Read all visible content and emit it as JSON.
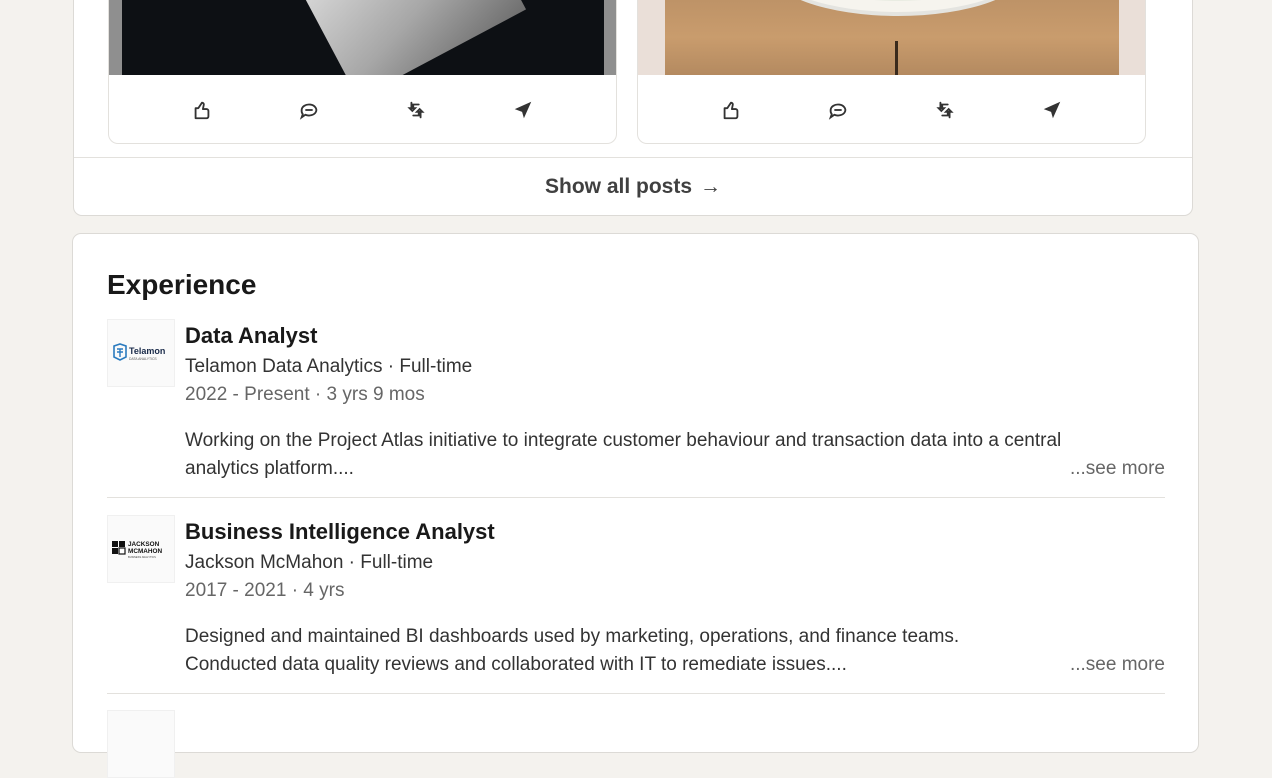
{
  "posts": {
    "show_all_label": "Show all posts",
    "show_all_arrow": "→",
    "action_icons": [
      "like-icon",
      "comment-icon",
      "repost-icon",
      "send-icon"
    ]
  },
  "experience": {
    "title": "Experience",
    "entries": [
      {
        "role": "Data Analyst",
        "company": "Telamon Data Analytics · Full-time",
        "dates": "2022 - Present · 3 yrs 9 mos",
        "desc_line1": "Working on the Project Atlas initiative to integrate customer behaviour and transaction data into a central",
        "desc_line2": "analytics platform....",
        "see_more": "...see more",
        "logo_text": "Telamon",
        "logo_sub": "DATA ANALYTICS"
      },
      {
        "role": "Business Intelligence Analyst",
        "company": "Jackson McMahon · Full-time",
        "dates": "2017 - 2021 · 4 yrs",
        "desc_line1": "Designed and maintained BI dashboards used by marketing, operations, and finance teams.",
        "desc_line2": "Conducted data quality reviews and collaborated with IT to remediate issues....",
        "see_more": "...see more",
        "logo_text1": "JACKSON",
        "logo_text2": "MCMAHON",
        "logo_sub": "BUSINESS ANALYTICS"
      }
    ]
  },
  "colors": {
    "page_bg": "#f4f2ee",
    "card_bg": "#ffffff",
    "telamon_blue": "#2b7bbf"
  }
}
